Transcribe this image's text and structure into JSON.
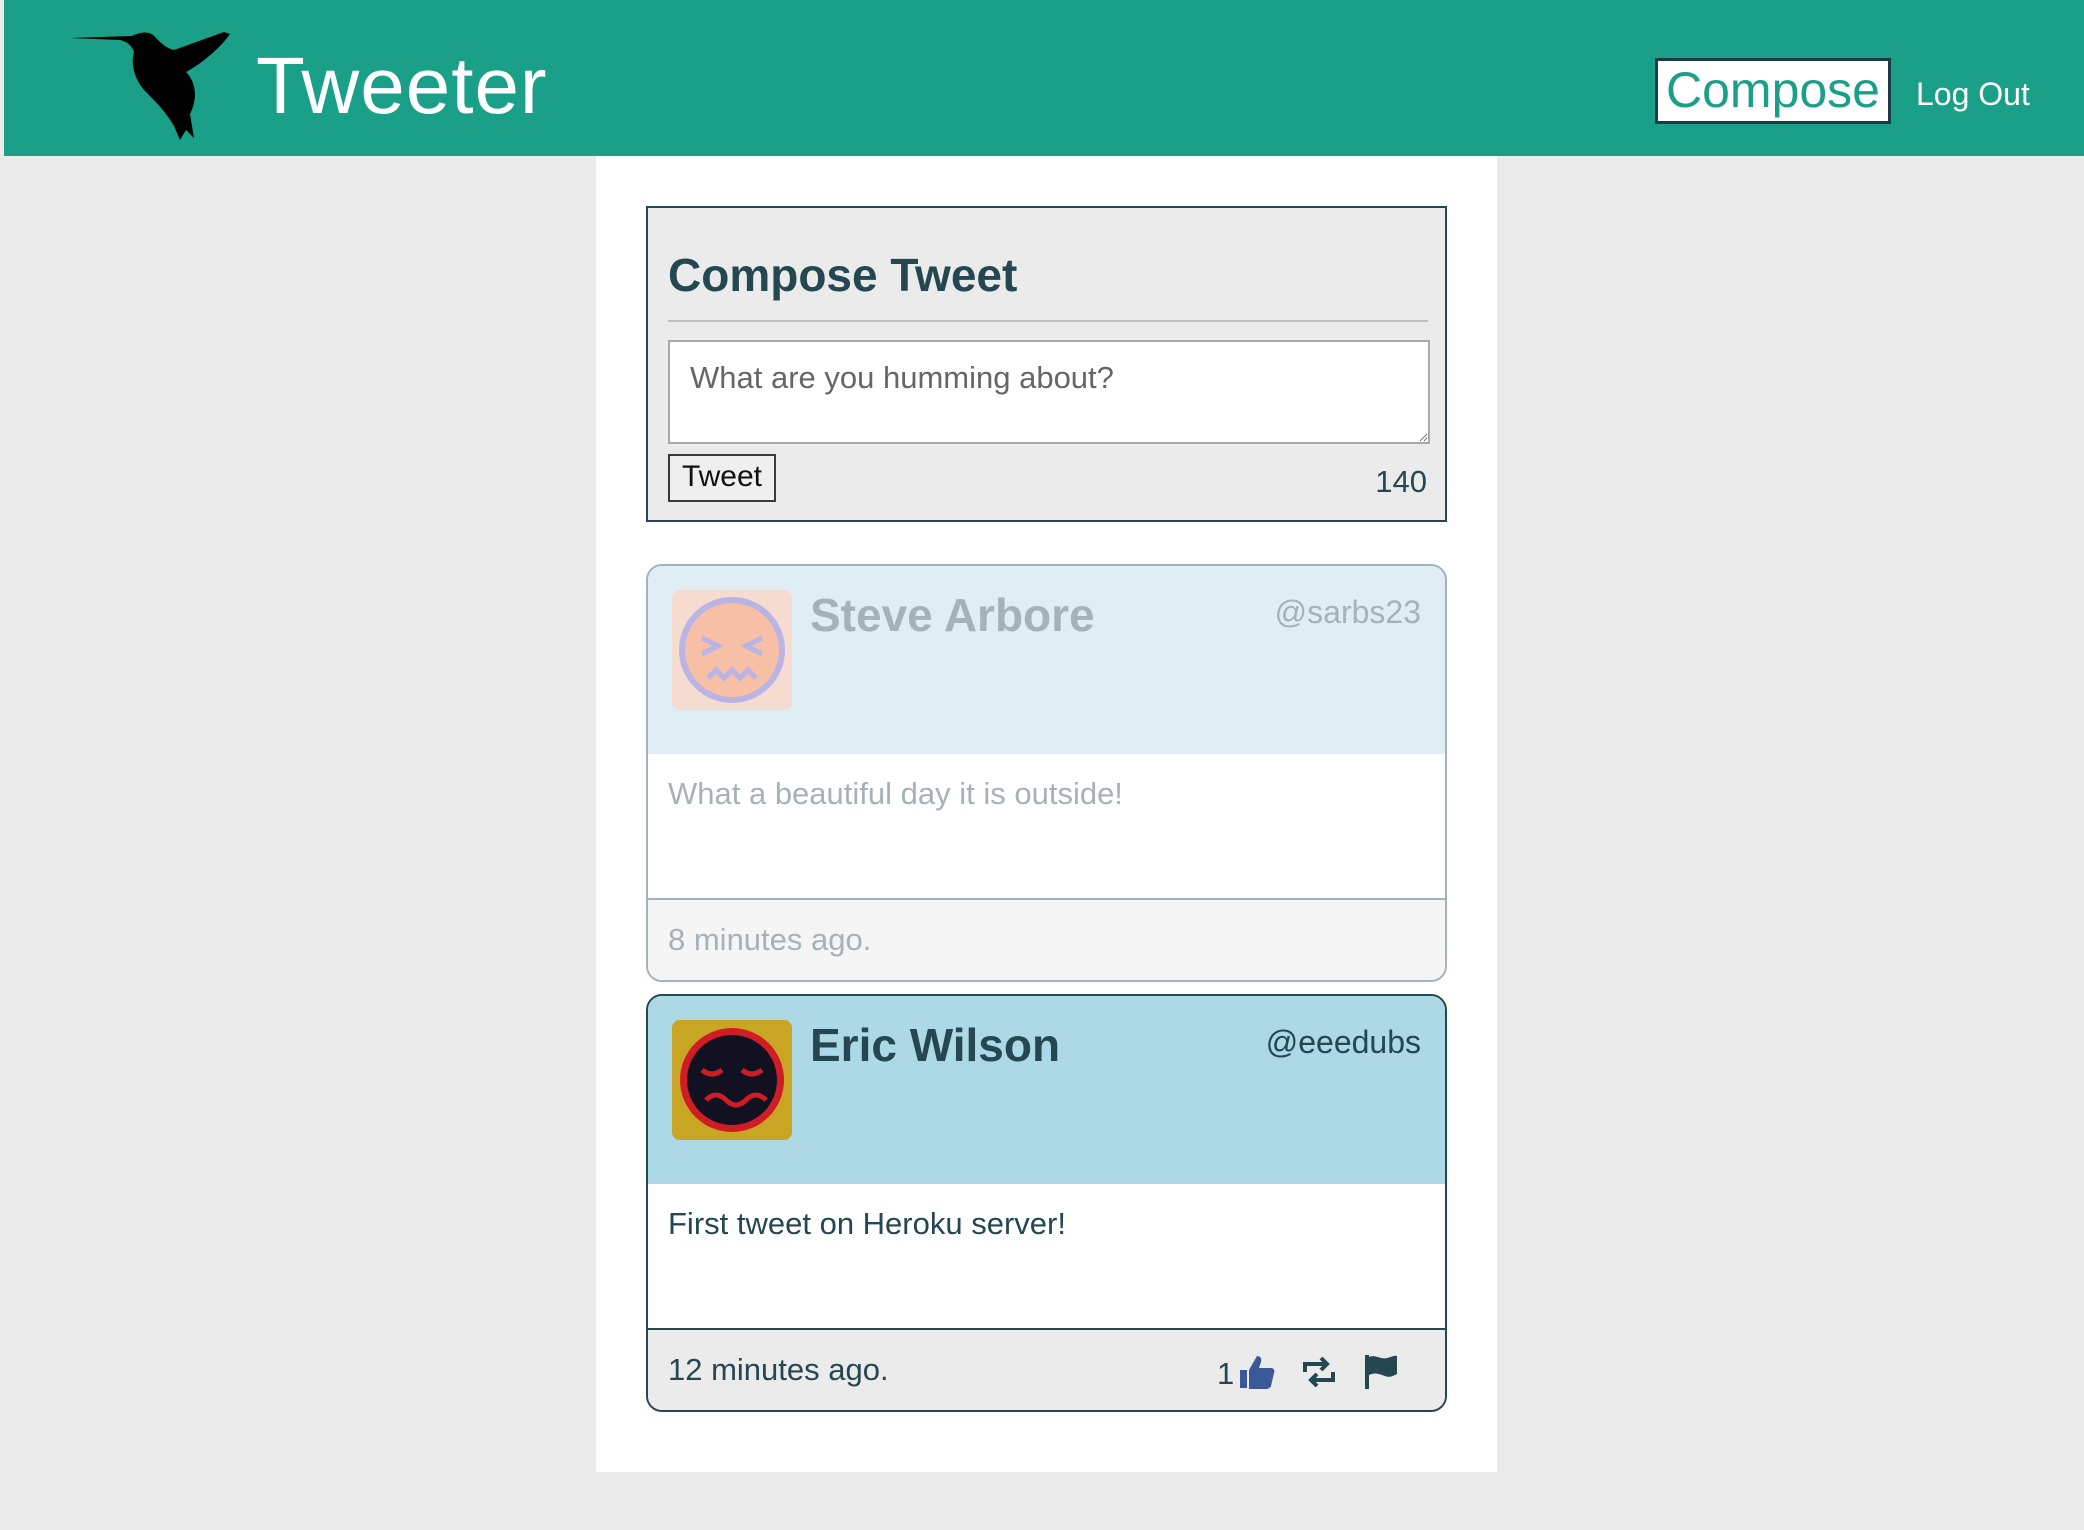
{
  "navbar": {
    "brand": "Tweeter",
    "compose_label": "Compose",
    "logout_label": "Log Out",
    "color": "#1aa089"
  },
  "compose": {
    "title": "Compose Tweet",
    "placeholder": "What are you humming about?",
    "submit_label": "Tweet",
    "counter": "140"
  },
  "tweets": [
    {
      "name": "Steve Arbore",
      "handle": "@sarbs23",
      "content": "What a beautiful day it is outside!",
      "time": "8 minutes ago.",
      "avatar": "confounded-face-avatar",
      "state": "faded"
    },
    {
      "name": "Eric Wilson",
      "handle": "@eeedubs",
      "content": "First tweet on Heroku server!",
      "time": "12 minutes ago.",
      "likes": "1",
      "avatar": "queasy-face-avatar",
      "icons": [
        "thumbs-up-icon",
        "retweet-icon",
        "flag-icon"
      ],
      "state": "active"
    }
  ]
}
